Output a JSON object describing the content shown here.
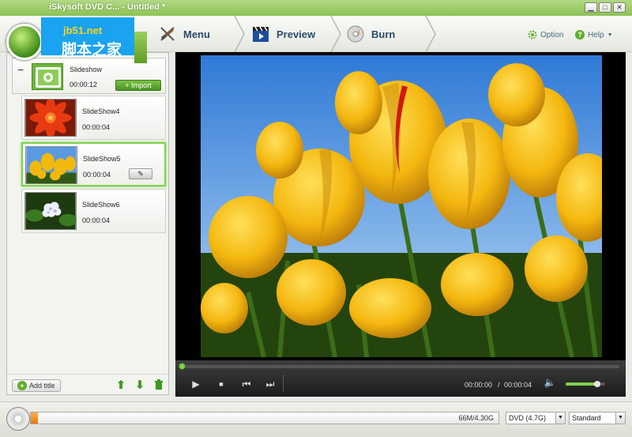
{
  "window": {
    "title": "iSkysoft DVD C...  - Untitled *",
    "minimize_icon": "minimize-icon",
    "restore_icon": "restore-icon",
    "close_icon": "close-icon"
  },
  "watermark": {
    "url": "jb51.net",
    "text": "脚本之家"
  },
  "steps": [
    {
      "label": "Menu",
      "icon": "wand-icon"
    },
    {
      "label": "Preview",
      "icon": "clapper-icon"
    },
    {
      "label": "Burn",
      "icon": "disc-burn-icon"
    }
  ],
  "header_links": {
    "option": "Option",
    "help": "Help"
  },
  "titles_panel": {
    "group": {
      "collapse_symbol": "−",
      "name": "Slideshow",
      "duration": "00:00:12",
      "import_label": "Import"
    },
    "items": [
      {
        "name": "SlideShow4",
        "duration": "00:00:04",
        "thumb": "red-flower"
      },
      {
        "name": "SlideShow5",
        "duration": "00:00:04",
        "thumb": "tulips",
        "selected": true
      },
      {
        "name": "SlideShow6",
        "duration": "00:00:04",
        "thumb": "white-flower"
      }
    ],
    "add_title_label": "Add title"
  },
  "player": {
    "current_time": "00:00:00",
    "separator": "/",
    "total_time": "00:00:04",
    "seek_progress": 0.0,
    "volume_level": 0.8
  },
  "bottom": {
    "capacity_text": "66M/4.30G",
    "capacity_fraction": 0.015,
    "disc_type": "DVD (4.7G)",
    "quality": "Standard"
  },
  "colors": {
    "accent_green": "#7fd14d",
    "step_text": "#2b4a6b",
    "capacity_orange": "#e07a12"
  }
}
